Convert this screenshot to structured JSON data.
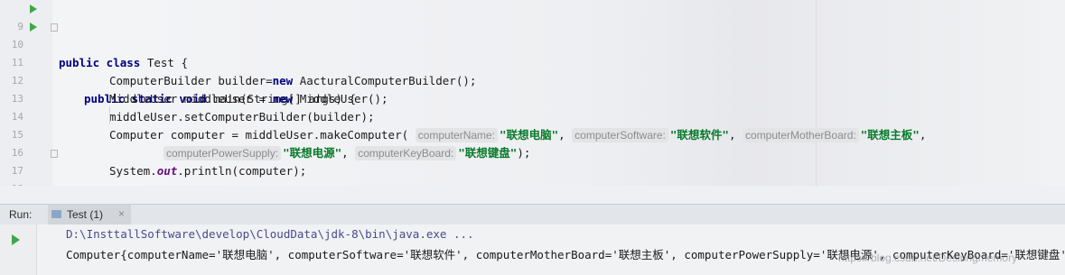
{
  "editor": {
    "line_numbers": [
      "9",
      "10",
      "11",
      "12",
      "13",
      "14",
      "15",
      "16",
      "17",
      "18"
    ],
    "lines": {
      "l9_kw": "public class ",
      "l9_rest": "Test {",
      "l10_kw": "public static void ",
      "l10_rest": "main(String[] args) {",
      "l11_a": "ComputerBuilder builder=",
      "l11_kw": "new ",
      "l11_b": "AacturalComputerBuilder();",
      "l12_a": "MiddleUser middleUser = ",
      "l12_kw": "new ",
      "l12_b": "MiddleUser();",
      "l13": "middleUser.setComputerBuilder(builder);",
      "l14_a": "Computer computer = middleUser.makeComputer(",
      "l14_h1": "computerName:",
      "l14_s1": "\"联想电脑\"",
      "l14_h2": "computerSoftware:",
      "l14_s2": "\"联想软件\"",
      "l14_h3": "computerMotherBoard:",
      "l14_s3": "\"联想主板\"",
      "l15_h1": "computerPowerSupply:",
      "l15_s1": "\"联想电源\"",
      "l15_h2": "computerKeyBoard:",
      "l15_s2": "\"联想键盘\"",
      "l15_end": ");",
      "l16_a": "System.",
      "l16_fld": "out",
      "l16_b": ".println(computer);",
      "l17": "}",
      "l18": "}"
    }
  },
  "run_panel": {
    "label": "Run:",
    "tab_label": "Test (1)",
    "tab_close": "×"
  },
  "console": {
    "command": "D:\\InsttallSoftware\\develop\\CloudData\\jdk-8\\bin\\java.exe ...",
    "output": "Computer{computerName='联想电脑', computerSoftware='联想软件', computerMotherBoard='联想主板', computerPowerSupply='联想电源', computerKeyBoard='联想键盘'}"
  },
  "watermark": "https://blog.csdn.net/Desiringmemory",
  "colors": {
    "keyword": "#000080",
    "string": "#087a2a",
    "run_green": "#3fa74a"
  }
}
